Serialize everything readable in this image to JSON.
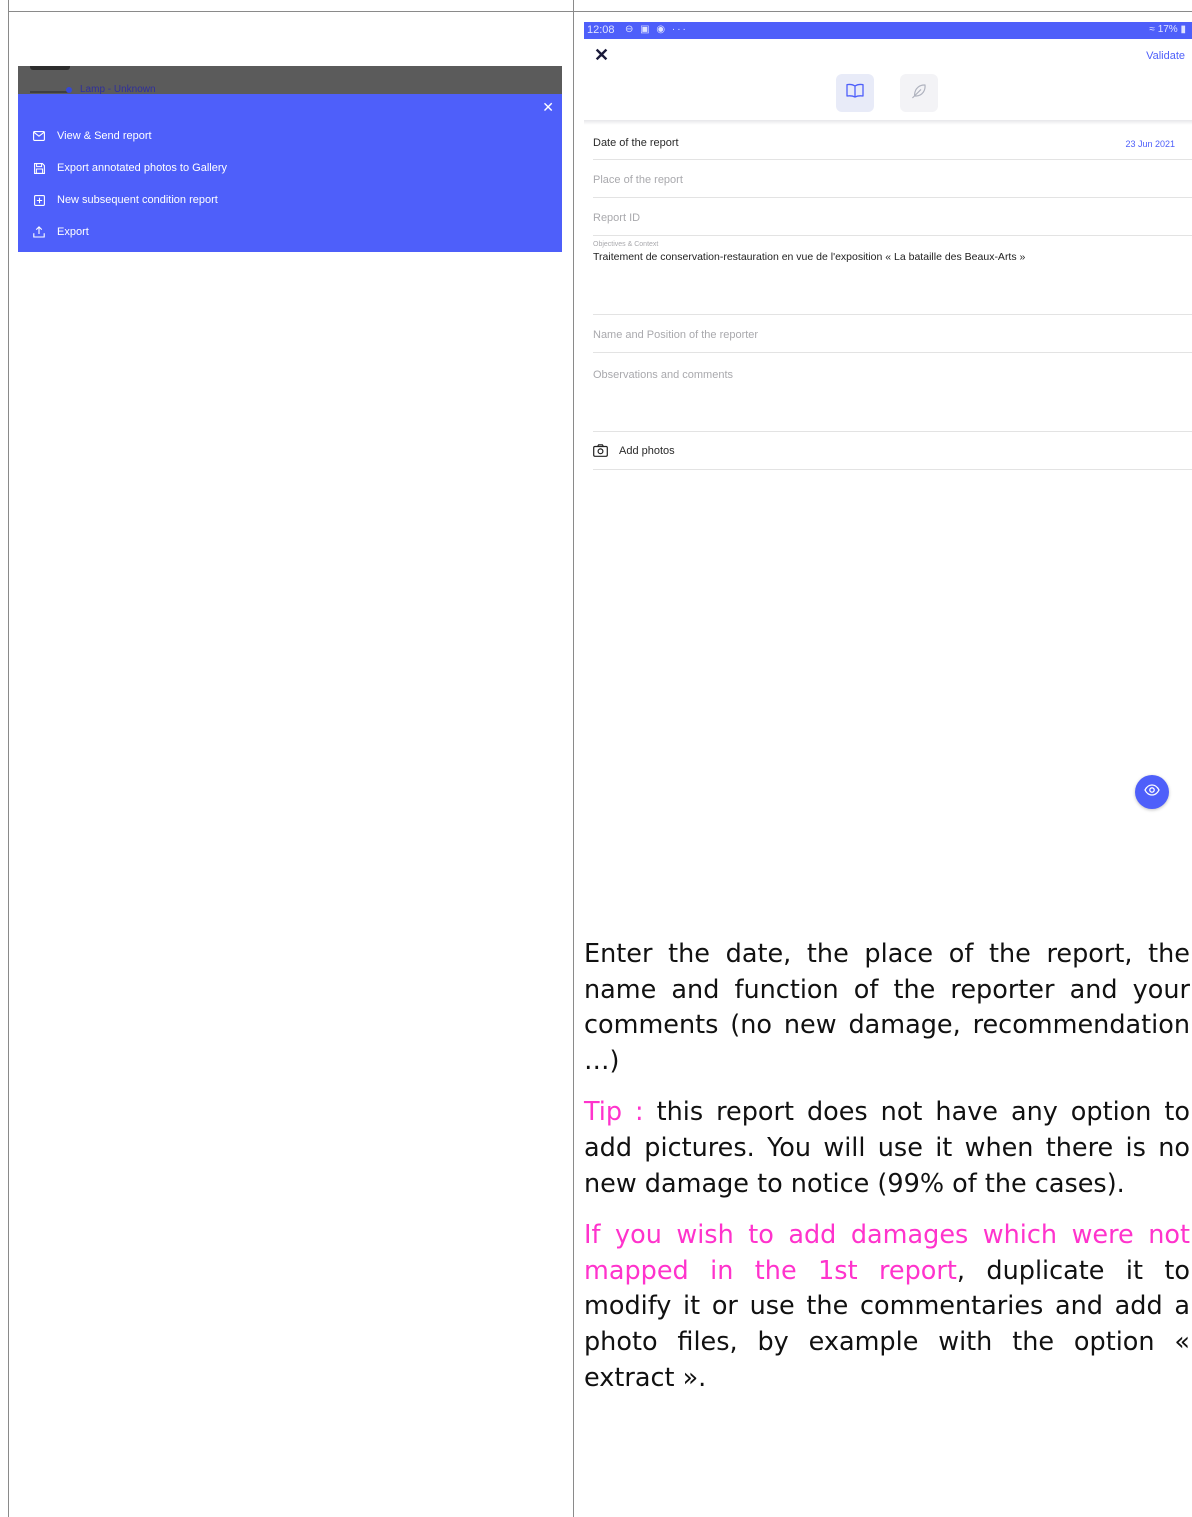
{
  "background_list": {
    "visible_item": "Lamp - Unknown"
  },
  "menu": {
    "close_icon": "close-icon",
    "items": [
      {
        "label": "View & Send report",
        "icon": "mail-icon"
      },
      {
        "label": "Export annotated photos to Gallery",
        "icon": "save-icon"
      },
      {
        "label": "New subsequent condition report",
        "icon": "plus-square-icon"
      },
      {
        "label": "Export",
        "icon": "upload-icon"
      }
    ]
  },
  "phone": {
    "status_bar": {
      "time": "12:08",
      "battery": "17%"
    },
    "header": {
      "validate_label": "Validate"
    },
    "tabs": [
      {
        "icon": "book-icon",
        "active": true
      },
      {
        "icon": "feather-icon",
        "active": false
      }
    ],
    "form": {
      "date_label": "Date of the report",
      "date_value": "23 Jun 2021",
      "place_placeholder": "Place of the report",
      "report_id_placeholder": "Report ID",
      "objectives_label": "Objectives & Context",
      "objectives_value": "Traitement de conservation-restauration en vue de l'exposition « La bataille des Beaux-Arts »",
      "reporter_placeholder": "Name and Position of the reporter",
      "observations_placeholder": "Observations and comments",
      "add_photos_label": "Add photos"
    }
  },
  "instructions": {
    "p1": "Enter the date, the place of the report, the name and function of the reporter and your comments (no new damage, recommendation …)",
    "tip_prefix": "Tip :",
    "tip_text": " this report does not have any option to add pictures. You will use it when there is no new damage to notice (99% of the cases).",
    "p3_highlight": "If you wish to add damages which were not mapped in the 1st report",
    "p3_text": ", duplicate it to modify it or use the commentaries and add a photo files, by example with the option « extract ».",
    "highlight_color": "#ff33cc"
  }
}
